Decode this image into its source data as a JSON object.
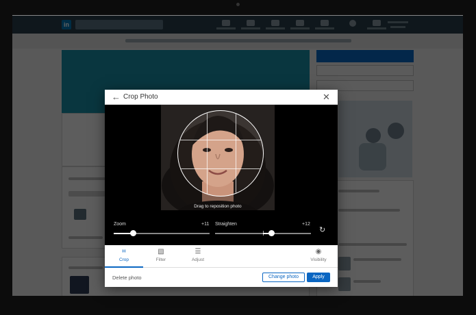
{
  "modal": {
    "title": "Crop Photo",
    "back_icon": "←",
    "close_icon": "✕",
    "hint": "Drag to reposition photo"
  },
  "sliders": {
    "zoom": {
      "label": "Zoom",
      "value": "+11",
      "level": 0.2
    },
    "straighten": {
      "label": "Straighten",
      "value": "+12",
      "level": 0.59
    },
    "reset_icon": "↻"
  },
  "tabs": [
    {
      "label": "Crop",
      "icon": "⌗",
      "active": true
    },
    {
      "label": "Filter",
      "icon": "▧",
      "active": false
    },
    {
      "label": "Adjust",
      "icon": "☰",
      "active": false
    },
    {
      "label": "Visibility",
      "icon": "◉",
      "active": false
    }
  ],
  "footer": {
    "delete_label": "Delete photo",
    "change_label": "Change photo",
    "apply_label": "Apply"
  },
  "colors": {
    "accent": "#0a66c2",
    "navbar": "#283e4a",
    "cover": "#1a8fa6"
  }
}
